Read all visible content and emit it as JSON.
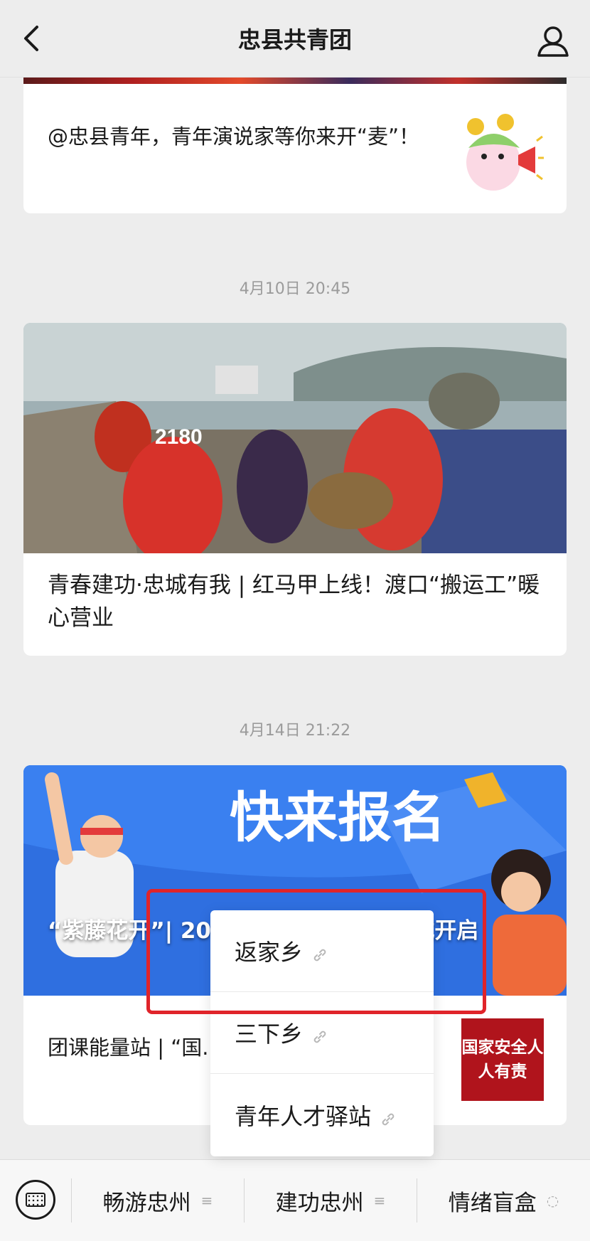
{
  "header": {
    "title": "忠县共青团"
  },
  "articles": [
    {
      "title": "@忠县青年，青年演说家等你来开“麦”！"
    },
    {
      "time": "4月10日 20:45",
      "title": "青春建功·忠城有我 | 红马甲上线！渡口“搬运工”暖心营业"
    },
    {
      "time": "4月14日 21:22",
      "poster_text": "快来报名",
      "title": "“紫藤花开”| 20...志愿者报名通道正式开启",
      "sub_title": "团课能量站 | “国...团日学习资料包",
      "thumb_text": "国家安全人人有责"
    }
  ],
  "popup_menu": {
    "items": [
      "返家乡",
      "三下乡",
      "青年人才驿站"
    ]
  },
  "bottom_menu": {
    "items": [
      "畅游忠州",
      "建功忠州",
      "情绪盲盒"
    ]
  },
  "colors": {
    "highlight": "#e0242a",
    "accent_red": "#d93a35",
    "poster_blue": "#2f6fe0"
  }
}
